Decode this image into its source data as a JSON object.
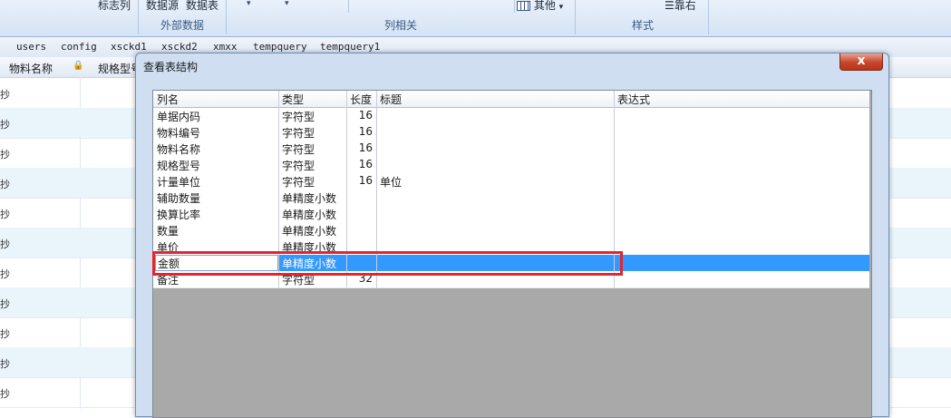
{
  "ribbon": {
    "flag_col": "标志列",
    "data_source": "数据源",
    "data_table": "数据表",
    "other": "其他",
    "lock_right": "靠右",
    "external_data": "外部数据",
    "column_related": "列相关",
    "style": "样式"
  },
  "tabs": [
    "users",
    "config",
    "xsckd1",
    "xsckd2",
    "xmxx",
    "tempquery",
    "tempquery1"
  ],
  "grid": {
    "col1": "物料名称",
    "col2": "规格型号",
    "row_text": "抄"
  },
  "dialog": {
    "title": "查看表结构",
    "close": "x",
    "headers": [
      "列名",
      "类型",
      "长度",
      "标题",
      "表达式"
    ],
    "rows": [
      {
        "name": "单据内码",
        "type": "字符型",
        "len": "16",
        "title": "",
        "expr": ""
      },
      {
        "name": "物料编号",
        "type": "字符型",
        "len": "16",
        "title": "",
        "expr": ""
      },
      {
        "name": "物料名称",
        "type": "字符型",
        "len": "16",
        "title": "",
        "expr": ""
      },
      {
        "name": "规格型号",
        "type": "字符型",
        "len": "16",
        "title": "",
        "expr": ""
      },
      {
        "name": "计量单位",
        "type": "字符型",
        "len": "16",
        "title": "单位",
        "expr": ""
      },
      {
        "name": "辅助数量",
        "type": "单精度小数",
        "len": "",
        "title": "",
        "expr": ""
      },
      {
        "name": "换算比率",
        "type": "单精度小数",
        "len": "",
        "title": "",
        "expr": ""
      },
      {
        "name": "数量",
        "type": "单精度小数",
        "len": "",
        "title": "",
        "expr": ""
      },
      {
        "name": "单价",
        "type": "单精度小数",
        "len": "",
        "title": "",
        "expr": ""
      },
      {
        "name": "金额",
        "type": "单精度小数",
        "len": "",
        "title": "",
        "expr": "",
        "selected": true
      },
      {
        "name": "备注",
        "type": "字符型",
        "len": "32",
        "title": "",
        "expr": ""
      }
    ]
  }
}
